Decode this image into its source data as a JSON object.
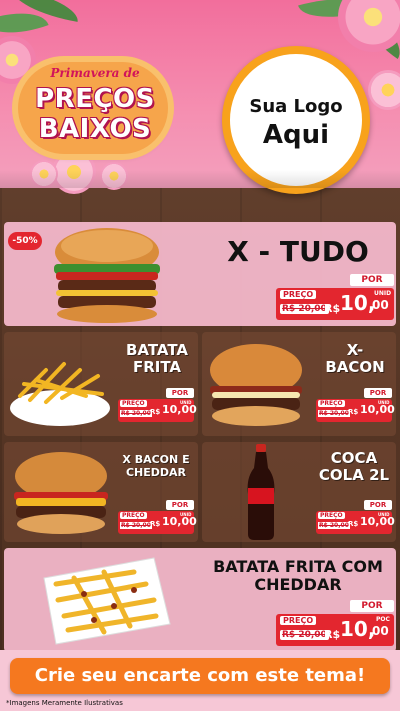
{
  "header": {
    "tagline": "Primavera de",
    "promo_line1": "PREÇOS",
    "promo_line2": "BAIXOS",
    "logo_line1": "Sua Logo",
    "logo_line2": "Aqui"
  },
  "discount_badge": "-50%",
  "products": [
    {
      "name": "X - TUDO",
      "label": "PREÇO",
      "old_price": "R$ 20,00",
      "por": "POR",
      "currency": "R$",
      "price_int": "10,",
      "price_dec": "00",
      "unit": "UNID"
    },
    {
      "name_line1": "BATATA",
      "name_line2": "FRITA",
      "label": "PREÇO",
      "old_price": "R$ 20,00",
      "por": "POR",
      "currency": "R$",
      "price_int": "10,00",
      "unit": "UNID"
    },
    {
      "name_line1": "X-",
      "name_line2": "BACON",
      "label": "PREÇO",
      "old_price": "R$ 20,00",
      "por": "POR",
      "currency": "R$",
      "price_int": "10,00",
      "unit": "UNID"
    },
    {
      "name_line1": "X BACON E",
      "name_line2": "CHEDDAR",
      "label": "PREÇO",
      "old_price": "R$ 20,00",
      "por": "POR",
      "currency": "R$",
      "price_int": "10,00",
      "unit": "UNID"
    },
    {
      "name_line1": "COCA",
      "name_line2": "COLA 2L",
      "label": "PREÇO",
      "old_price": "R$ 20,00",
      "por": "POR",
      "currency": "R$",
      "price_int": "10,00",
      "unit": "UNID"
    },
    {
      "name_line1": "BATATA FRITA COM",
      "name_line2": "CHEDDAR",
      "label": "PREÇO",
      "old_price": "R$ 20,00",
      "por": "POR",
      "currency": "R$",
      "price_int": "10,",
      "price_dec": "00",
      "unit": "POC"
    }
  ],
  "cta": "Crie seu encarte com este tema!",
  "disclaimer": "*Imagens Meramente Ilustrativas",
  "icons": [
    "burger-icon",
    "fries-icon",
    "bacon-burger-icon",
    "cheddar-burger-icon",
    "cola-bottle-icon",
    "cheddar-fries-icon"
  ],
  "colors": {
    "accent": "#f5781f",
    "price_red": "#e3262f",
    "pink": "#f26e9c"
  }
}
